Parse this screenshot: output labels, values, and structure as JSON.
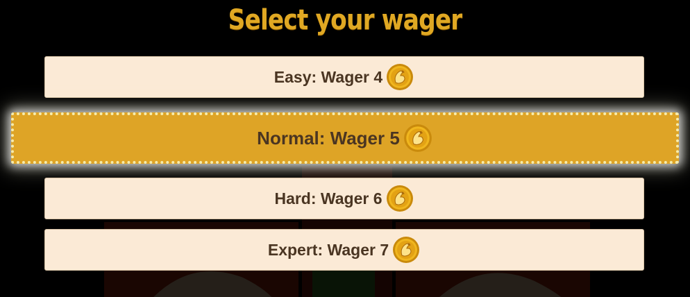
{
  "title": "Select your wager",
  "options": [
    {
      "label": "Easy: Wager 4",
      "selected": false
    },
    {
      "label": "Normal: Wager 5",
      "selected": true
    },
    {
      "label": "Hard: Wager 6",
      "selected": false
    },
    {
      "label": "Expert: Wager 7",
      "selected": false
    }
  ],
  "icons": {
    "currency": "gold-coin-icon"
  },
  "colors": {
    "background": "#000000",
    "title": "#e0a823",
    "option_bg": "#fbead6",
    "selected_bg": "#dea426",
    "selected_border": "#f6ecae",
    "text": "#4a3522"
  }
}
